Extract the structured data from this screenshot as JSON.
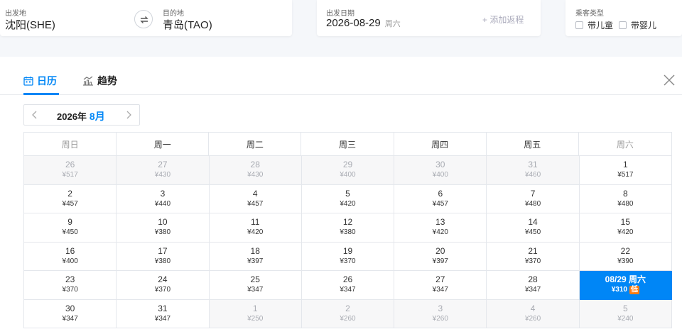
{
  "search": {
    "departure_label": "出发地",
    "departure_value": "沈阳(SHE)",
    "destination_label": "目的地",
    "destination_value": "青岛(TAO)",
    "date_label": "出发日期",
    "date_value": "2026-08-29",
    "date_weekday": "周六",
    "add_return": "+ 添加返程",
    "passenger_label": "乘客类型",
    "passenger_options": [
      "带儿童",
      "带婴儿"
    ]
  },
  "tabs": [
    {
      "label": "日历",
      "icon": "calendar-icon",
      "active": true
    },
    {
      "label": "趋势",
      "icon": "trend-chart-icon",
      "active": false
    }
  ],
  "month_selector": {
    "year": "2026年",
    "month": "8月"
  },
  "weekdays": [
    "周日",
    "周一",
    "周二",
    "周三",
    "周四",
    "周五",
    "周六"
  ],
  "calendar": [
    {
      "day": "26",
      "price": "¥517",
      "off": true
    },
    {
      "day": "27",
      "price": "¥430",
      "off": true
    },
    {
      "day": "28",
      "price": "¥430",
      "off": true
    },
    {
      "day": "29",
      "price": "¥400",
      "off": true
    },
    {
      "day": "30",
      "price": "¥400",
      "off": true
    },
    {
      "day": "31",
      "price": "¥460",
      "off": true
    },
    {
      "day": "1",
      "price": "¥517"
    },
    {
      "day": "2",
      "price": "¥457"
    },
    {
      "day": "3",
      "price": "¥440"
    },
    {
      "day": "4",
      "price": "¥457"
    },
    {
      "day": "5",
      "price": "¥420"
    },
    {
      "day": "6",
      "price": "¥457"
    },
    {
      "day": "7",
      "price": "¥480"
    },
    {
      "day": "8",
      "price": "¥480"
    },
    {
      "day": "9",
      "price": "¥450"
    },
    {
      "day": "10",
      "price": "¥380"
    },
    {
      "day": "11",
      "price": "¥420"
    },
    {
      "day": "12",
      "price": "¥380"
    },
    {
      "day": "13",
      "price": "¥420"
    },
    {
      "day": "14",
      "price": "¥450"
    },
    {
      "day": "15",
      "price": "¥420"
    },
    {
      "day": "16",
      "price": "¥400"
    },
    {
      "day": "17",
      "price": "¥380"
    },
    {
      "day": "18",
      "price": "¥397"
    },
    {
      "day": "19",
      "price": "¥370"
    },
    {
      "day": "20",
      "price": "¥397"
    },
    {
      "day": "21",
      "price": "¥370"
    },
    {
      "day": "22",
      "price": "¥390"
    },
    {
      "day": "23",
      "price": "¥370"
    },
    {
      "day": "24",
      "price": "¥370"
    },
    {
      "day": "25",
      "price": "¥347"
    },
    {
      "day": "26",
      "price": "¥347"
    },
    {
      "day": "27",
      "price": "¥347"
    },
    {
      "day": "28",
      "price": "¥347"
    },
    {
      "day": "08/29 周六",
      "price": "¥310",
      "selected": true,
      "badge": "低"
    },
    {
      "day": "30",
      "price": "¥347"
    },
    {
      "day": "31",
      "price": "¥347"
    },
    {
      "day": "1",
      "price": "¥250",
      "off": true
    },
    {
      "day": "2",
      "price": "¥260",
      "off": true
    },
    {
      "day": "3",
      "price": "¥260",
      "off": true
    },
    {
      "day": "4",
      "price": "¥260",
      "off": true
    },
    {
      "day": "5",
      "price": "¥240",
      "off": true
    }
  ],
  "colors": {
    "accent": "#0086f6",
    "low_badge": "#ff7d13",
    "off_bg": "#f7f7f8"
  }
}
